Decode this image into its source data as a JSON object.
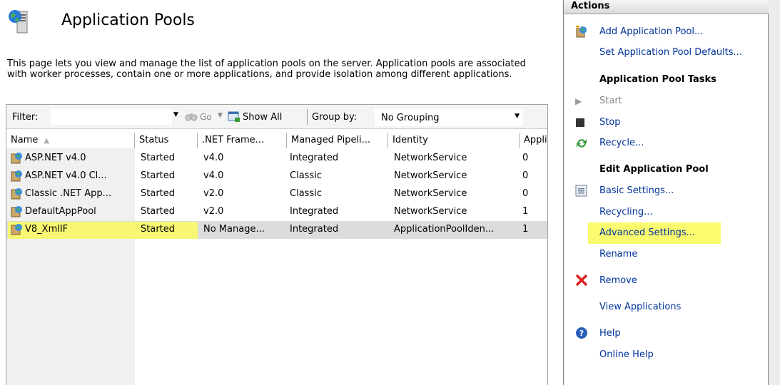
{
  "header": {
    "title": "Application Pools",
    "description": "This page lets you view and manage the list of application pools on the server. Application pools are associated with worker processes, contain one or more applications, and provide isolation among different applications."
  },
  "filter_bar": {
    "filter_label": "Filter:",
    "filter_value": "",
    "go_label": "Go",
    "show_all_label": "Show All",
    "group_by_label": "Group by:",
    "group_by_value": "No Grouping"
  },
  "grid": {
    "columns": [
      "Name",
      "Status",
      ".NET Frame...",
      "Managed Pipeli...",
      "Identity",
      "Appli"
    ],
    "rows": [
      {
        "name": "ASP.NET v4.0",
        "status": "Started",
        "net": "v4.0",
        "pipeline": "Integrated",
        "identity": "NetworkService",
        "apps": "0"
      },
      {
        "name": "ASP.NET v4.0 Cl...",
        "status": "Started",
        "net": "v4.0",
        "pipeline": "Classic",
        "identity": "NetworkService",
        "apps": "0"
      },
      {
        "name": "Classic .NET App...",
        "status": "Started",
        "net": "v2.0",
        "pipeline": "Classic",
        "identity": "NetworkService",
        "apps": "0"
      },
      {
        "name": "DefaultAppPool",
        "status": "Started",
        "net": "v2.0",
        "pipeline": "Integrated",
        "identity": "NetworkService",
        "apps": "1"
      },
      {
        "name": "V8_XmlIF",
        "status": "Started",
        "net": "No Manage...",
        "pipeline": "Integrated",
        "identity": "ApplicationPoolIden...",
        "apps": "1"
      }
    ],
    "selected_row": 4
  },
  "actions": {
    "title": "Actions",
    "add_pool": "Add Application Pool...",
    "set_defaults": "Set Application Pool Defaults...",
    "tasks_header": "Application Pool Tasks",
    "start": "Start",
    "stop": "Stop",
    "recycle": "Recycle...",
    "edit_header": "Edit Application Pool",
    "basic_settings": "Basic Settings...",
    "recycling": "Recycling...",
    "advanced_settings": "Advanced Settings...",
    "rename": "Rename",
    "remove": "Remove",
    "view_apps": "View Applications",
    "help": "Help",
    "online_help": "Online Help"
  },
  "colors": {
    "highlight": "#fbfb60",
    "link": "#003399",
    "selected_row": "#dcdcdc",
    "remove_icon": "#e02020"
  }
}
